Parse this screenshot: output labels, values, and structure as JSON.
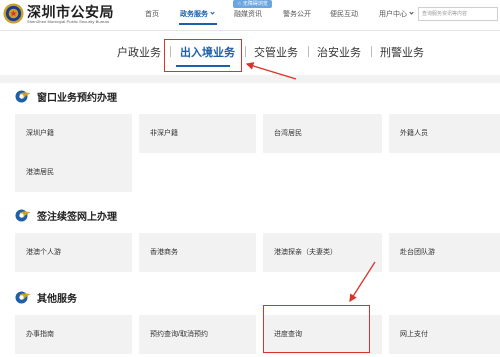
{
  "header": {
    "site_title": "深圳市公安局",
    "site_subtitle": "ShenZhen Municipal Public Security Bureau",
    "nav": [
      {
        "label": "首页"
      },
      {
        "label": "政务服务"
      },
      {
        "label": "融媒资讯"
      },
      {
        "label": "警务公开"
      },
      {
        "label": "便民互动"
      },
      {
        "label": "用户中心"
      }
    ],
    "nav_tag": "☆ 无障碍浏览",
    "search_placeholder": "查询服务资讯等内容"
  },
  "category_tabs": [
    {
      "label": "户政业务"
    },
    {
      "label": "出入境业务"
    },
    {
      "label": "交管业务"
    },
    {
      "label": "治安业务"
    },
    {
      "label": "刑警业务"
    }
  ],
  "sections": [
    {
      "title": "窗口业务预约办理",
      "cards": [
        "深圳户籍",
        "非深户籍",
        "台湾居民",
        "外籍人员",
        "港澳居民"
      ]
    },
    {
      "title": "签注续签网上办理",
      "cards": [
        "港澳个人游",
        "香港商务",
        "港澳探亲（夫妻类）",
        "赴台团队游"
      ]
    },
    {
      "title": "其他服务",
      "cards": [
        "办事指南",
        "预约查询/取消预约",
        "进度查询",
        "网上支付"
      ]
    }
  ],
  "colors": {
    "accent": "#1d5fa8",
    "highlight": "#d9342b",
    "card_bg": "#f2f2f2"
  }
}
